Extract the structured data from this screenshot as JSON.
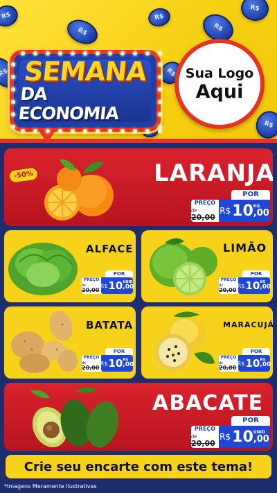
{
  "header": {
    "badge_line1": "SEMANA",
    "badge_line2": "DA ECONOMIA",
    "logo_line1": "Sua Logo",
    "logo_line2": "Aqui"
  },
  "colors": {
    "yellow": "#f6d21b",
    "red": "#d9232e",
    "blue": "#1f47d6",
    "navy": "#1d2d6e"
  },
  "products": {
    "laranja": {
      "name": "LARANJA",
      "discount": "-50%",
      "por": "POR",
      "preco": "PREÇO",
      "de": "de",
      "old_price": "20,00",
      "currency": "R$",
      "price_int": "10",
      "price_dec": ",00",
      "unit": "KG"
    },
    "alface": {
      "name": "ALFACE",
      "por": "POR",
      "preco": "PREÇO",
      "de": "de",
      "old_price": "20,00",
      "currency": "R$",
      "price_int": "10",
      "price_dec": ",00",
      "unit": "UNID"
    },
    "limao": {
      "name": "LIMÃO",
      "por": "POR",
      "preco": "PREÇO",
      "de": "de",
      "old_price": "20,00",
      "currency": "R$",
      "price_int": "10",
      "price_dec": ",00",
      "unit": "KG"
    },
    "batata": {
      "name": "BATATA",
      "por": "POR",
      "preco": "PREÇO",
      "de": "de",
      "old_price": "20,00",
      "currency": "R$",
      "price_int": "10",
      "price_dec": ",00",
      "unit": "KG"
    },
    "maracuja": {
      "name": "MARACUJÁ",
      "por": "POR",
      "preco": "PREÇO",
      "de": "de",
      "old_price": "20,00",
      "currency": "R$",
      "price_int": "10",
      "price_dec": ",00",
      "unit": "KG"
    },
    "abacate": {
      "name": "ABACATE",
      "por": "POR",
      "preco": "PREÇO",
      "de": "de",
      "old_price": "20,00",
      "currency": "R$",
      "price_int": "10",
      "price_dec": ",00",
      "unit": "UNID"
    }
  },
  "cta": "Crie seu encarte com este tema!",
  "footnote": "*Imagens Meramente Ilustrativas"
}
